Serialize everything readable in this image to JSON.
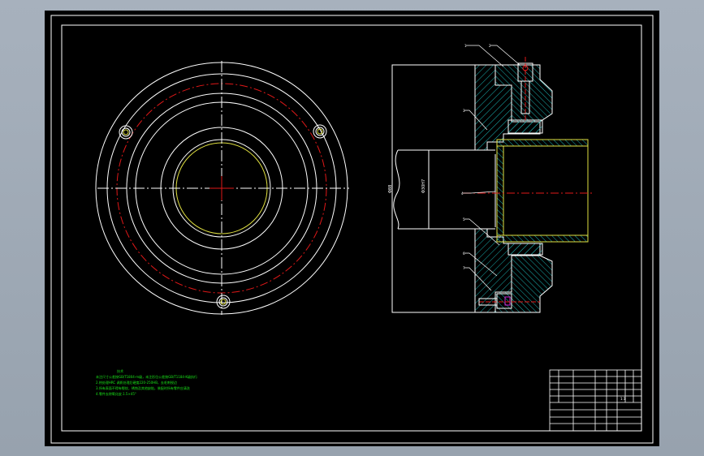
{
  "colors": {
    "background_bezel": "#9aa5b1",
    "drawing_bg": "#000000",
    "line_white": "#ffffff",
    "center_line_red": "#e01818",
    "hatch_cyan": "#1ab0b0",
    "bore_yellow": "#e0e040",
    "notes_green": "#19e619",
    "accent_magenta": "#d020d0"
  },
  "drawing": {
    "note_title": "技术",
    "notes": [
      "未注尺寸公差按GB/T1804-m级，未注形位公差按GB/T1184-K级执行",
      "2.热处理HRC 调质处理后硬度220-250HB，去毛刺锐边",
      "3.所有表面不得有裂纹，锈蚀及其他缺陷，装配时所有零件应清洗",
      "4.零件去除氧化皮.1.5×45°"
    ],
    "dimension_labels": [
      "Φ88",
      "Φ30H7"
    ],
    "leader_labels": [
      "1",
      "2",
      "3",
      "4",
      "5",
      "6",
      "7"
    ],
    "title_block": {
      "rows": [
        "",
        "",
        "",
        "",
        "",
        ""
      ],
      "scale": "1:1"
    }
  }
}
